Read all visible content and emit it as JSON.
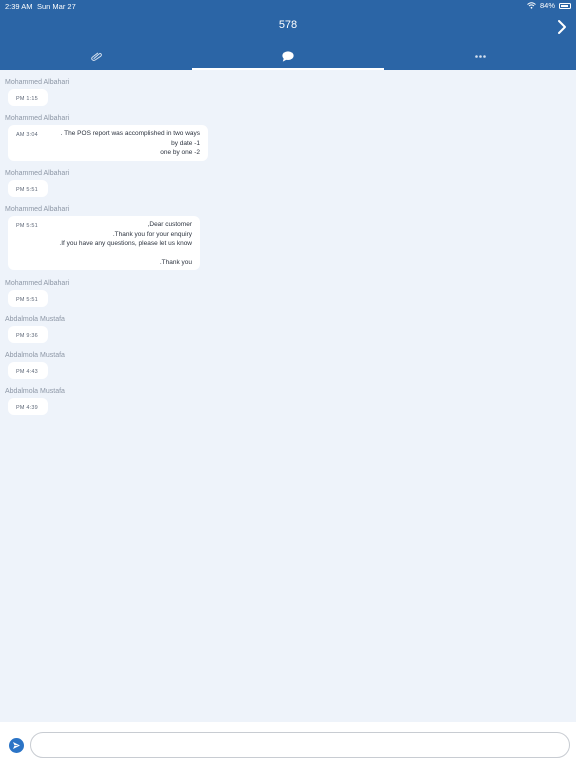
{
  "status_bar": {
    "time": "2:39 AM",
    "date": "Sun Mar 27",
    "battery_percent": "84%",
    "battery_level": 0.84
  },
  "header": {
    "title": "578"
  },
  "tabs": [
    {
      "icon": "paperclip-icon",
      "active": false
    },
    {
      "icon": "chat-bubble-icon",
      "active": true
    },
    {
      "icon": "more-dots-icon",
      "active": false
    }
  ],
  "messages": [
    {
      "sender": "Mohammed Albahari",
      "time": "PM 1:15",
      "text": ""
    },
    {
      "sender": "Mohammed Albahari",
      "time": "AM 3:04",
      "text": ". The POS report was accomplished in two ways\nby date -1\none by one -2"
    },
    {
      "sender": "Mohammed Albahari",
      "time": "PM 5:51",
      "text": ""
    },
    {
      "sender": "Mohammed Albahari",
      "time": "PM 5:51",
      "text": ",Dear customer\n.Thank you for your enquiry\n.If you have any questions, please let us know\n\n.Thank you"
    },
    {
      "sender": "Mohammed Albahari",
      "time": "PM 5:51",
      "text": ""
    },
    {
      "sender": "Abdalmola Mustafa",
      "time": "PM 9:36",
      "text": ""
    },
    {
      "sender": "Abdalmola Mustafa",
      "time": "PM 4:43",
      "text": ""
    },
    {
      "sender": "Abdalmola Mustafa",
      "time": "PM 4:39",
      "text": ""
    }
  ],
  "composer": {
    "value": "",
    "placeholder": ""
  },
  "colors": {
    "header": "#2b65a6",
    "background": "#eef3fa",
    "send_button": "#2b74c6"
  }
}
